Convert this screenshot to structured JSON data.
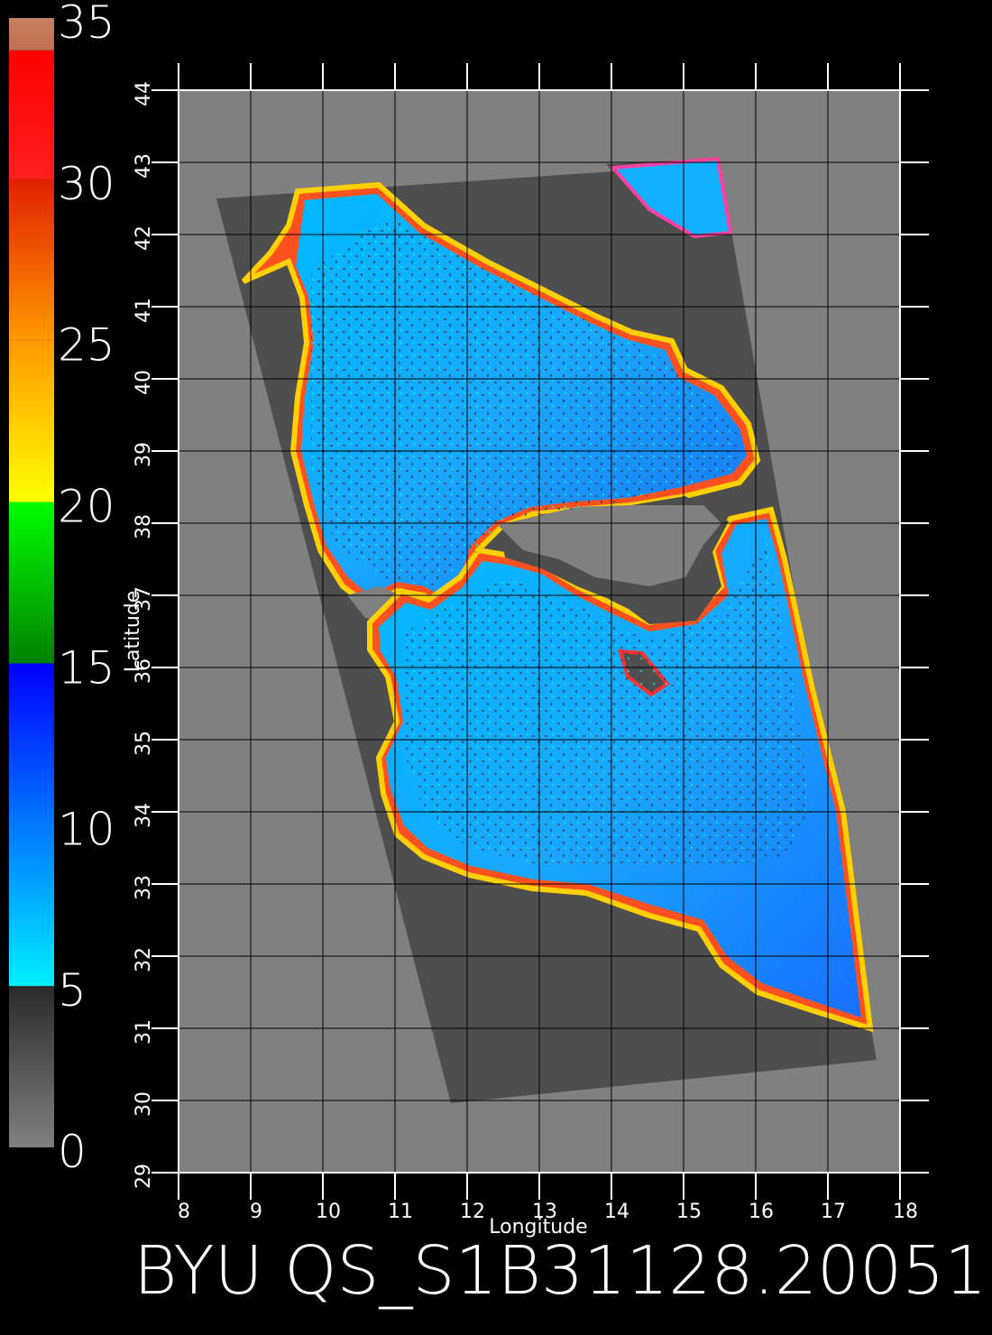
{
  "map": {
    "x_axis_label": "Longitude",
    "y_axis_label": "Latitude",
    "lon_ticks": [
      "8",
      "9",
      "10",
      "11",
      "12",
      "13",
      "14",
      "15",
      "16",
      "17",
      "18"
    ],
    "lat_ticks": [
      "29",
      "30",
      "31",
      "32",
      "33",
      "34",
      "35",
      "36",
      "37",
      "38",
      "39",
      "40",
      "41",
      "42",
      "43",
      "44"
    ],
    "lon_range": [
      8,
      18
    ],
    "lat_range": [
      29,
      44
    ],
    "grid": true
  },
  "colorbar": {
    "labels": [
      "0",
      "5",
      "10",
      "15",
      "20",
      "25",
      "30",
      "35"
    ],
    "range": [
      0,
      35
    ],
    "bands": [
      {
        "from": 0,
        "to": 5,
        "colors": [
          "#808080",
          "#2a2a2a"
        ]
      },
      {
        "from": 5,
        "to": 15,
        "colors": [
          "#00eeff",
          "#0000ff"
        ]
      },
      {
        "from": 15,
        "to": 20,
        "colors": [
          "#008000",
          "#00ff00"
        ]
      },
      {
        "from": 20,
        "to": 25,
        "colors": [
          "#ffff00",
          "#ff9900"
        ]
      },
      {
        "from": 25,
        "to": 30,
        "colors": [
          "#ff9900",
          "#e02000"
        ]
      },
      {
        "from": 30,
        "to": 34,
        "colors": [
          "#ff2020",
          "#ff0000"
        ]
      },
      {
        "from": 34,
        "to": 35,
        "colors": [
          "#c07050",
          "#c88060"
        ]
      }
    ]
  },
  "footer": {
    "title": "BYU  QS_S1B31128.20051"
  },
  "colors": {
    "background": "#000000",
    "plot_background": "#808080",
    "swath": "#505050",
    "land": "#404040",
    "sea_low": "#00c8ff",
    "sea_high": "#1060ff",
    "coast_edge": "#ff4000"
  }
}
